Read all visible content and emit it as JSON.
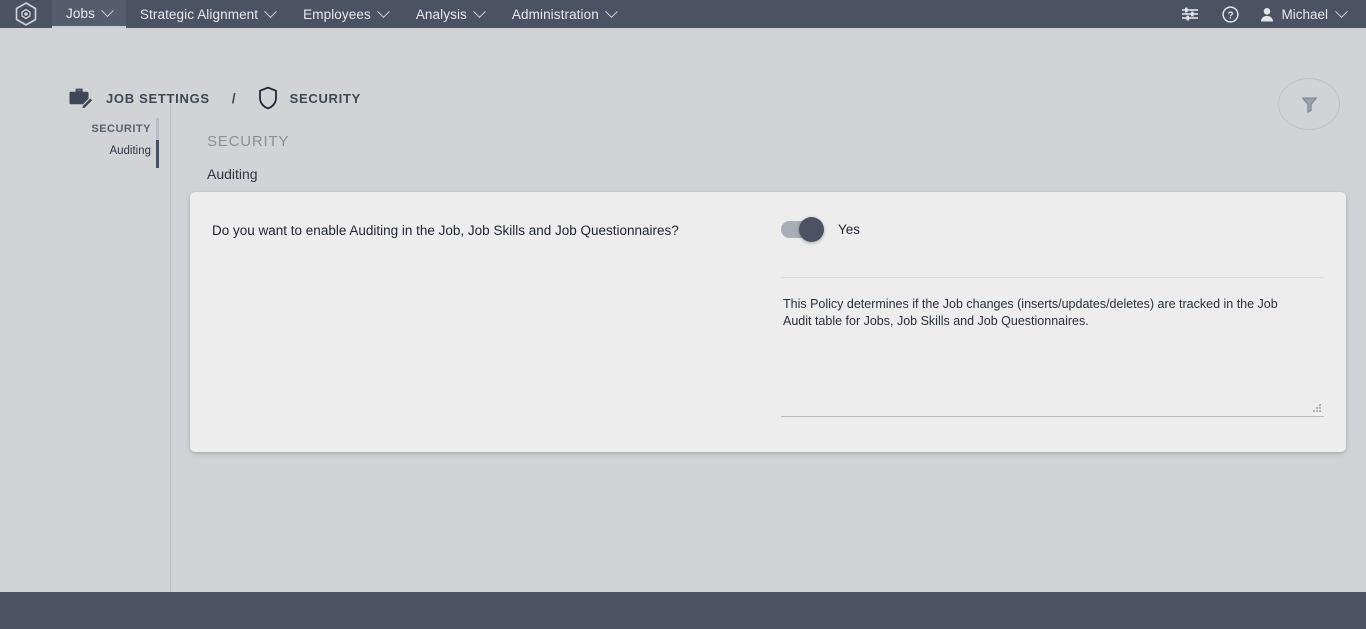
{
  "topnav": {
    "logo_icon": "hexagon-logo-icon",
    "items": [
      {
        "label": "Jobs",
        "icon": "chevron-down-icon",
        "active": true
      },
      {
        "label": "Strategic Alignment",
        "icon": "chevron-down-icon",
        "active": false
      },
      {
        "label": "Employees",
        "icon": "chevron-down-icon",
        "active": false
      },
      {
        "label": "Analysis",
        "icon": "chevron-down-icon",
        "active": false
      },
      {
        "label": "Administration",
        "icon": "chevron-down-icon",
        "active": false
      }
    ],
    "settings_icon": "sliders-icon",
    "help_icon": "help-circle-icon",
    "user": {
      "name": "Michael",
      "avatar_icon": "user-icon",
      "caret_icon": "chevron-down-icon"
    }
  },
  "header": {
    "breadcrumb": [
      {
        "label": "JOB SETTINGS",
        "icon": "briefcase-edit-icon"
      },
      {
        "label": "SECURITY",
        "icon": "shield-icon"
      }
    ],
    "separator": "/",
    "filter_button_icon": "funnel-icon"
  },
  "sidebar": {
    "heading": "SECURITY",
    "items": [
      {
        "label": "Auditing",
        "active": true
      }
    ]
  },
  "main": {
    "section_title": "SECURITY",
    "tabs": [
      {
        "label": "Auditing",
        "active": true
      }
    ],
    "card": {
      "question": "Do you want to enable Auditing in the Job, Job Skills and Job Questionnaires?",
      "toggle": {
        "value_label": "Yes",
        "state": "on"
      },
      "description": "This Policy determines if the Job changes (inserts/updates/deletes) are tracked in the Job Audit table for Jobs, Job Skills and Job Questionnaires.",
      "resize_handle_icon": "resize-grip-icon"
    }
  },
  "colors": {
    "nav_background": "#4b5263",
    "nav_active": "#545c6e",
    "page_background": "#d1d3d6",
    "card_background": "#ededed",
    "toggle_knob": "#4b5263",
    "toggle_track": "#a9adb7",
    "rail_active": "#464f63",
    "text_primary": "#1f2430",
    "text_muted": "#8b8f96"
  }
}
